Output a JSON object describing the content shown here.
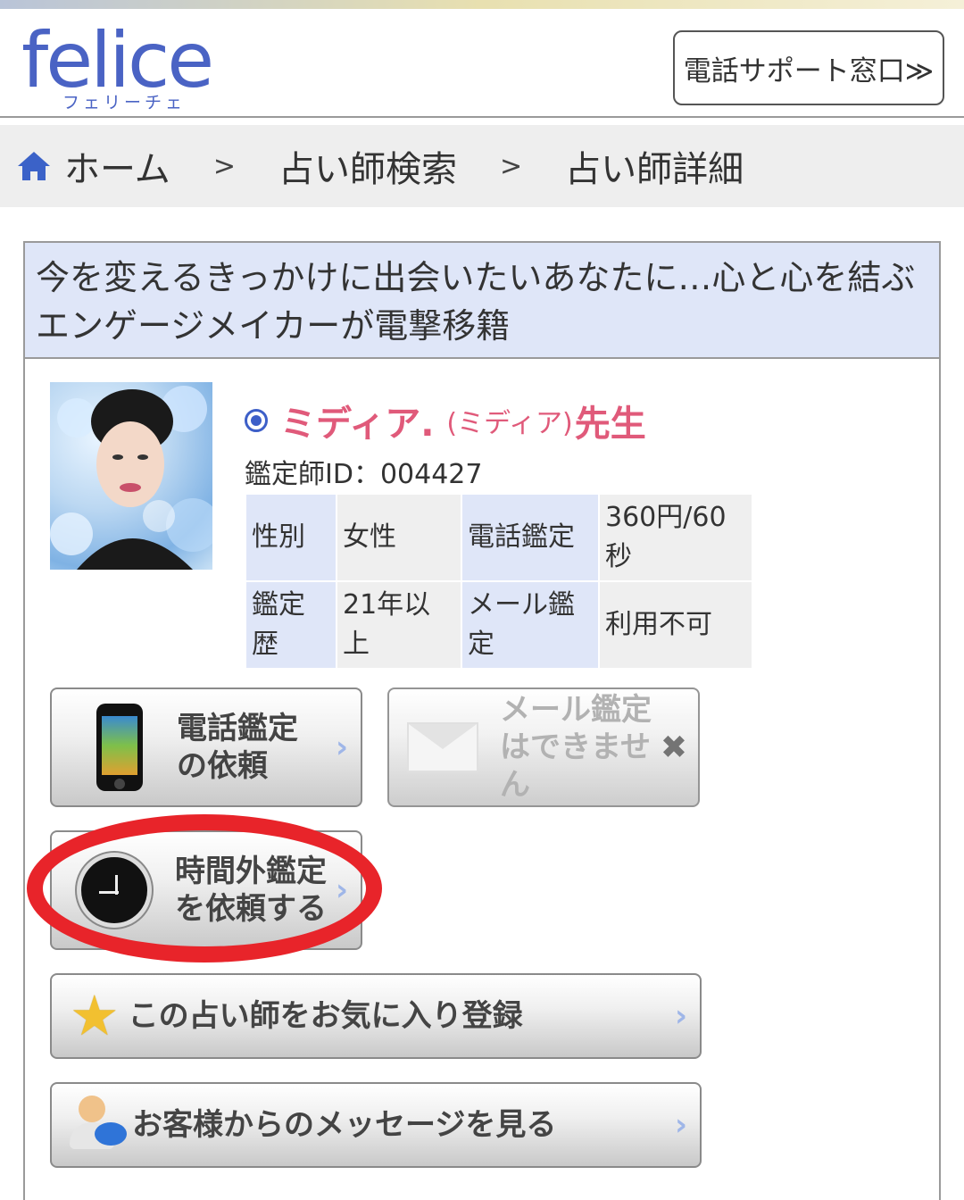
{
  "header": {
    "logo_text": "felice",
    "logo_subtext": "フェリーチェ",
    "support_button": "電話サポート窓口≫"
  },
  "breadcrumb": {
    "home": "ホーム",
    "separator": ">",
    "search": "占い師検索",
    "detail": "占い師詳細"
  },
  "profile": {
    "headline": "今を変えるきっかけに出会いたいあなたに…心と心を結ぶエンゲージメイカーが電撃移籍",
    "name": "ミディア.",
    "reading": "(ミディア)",
    "suffix": "先生",
    "reader_id": "鑑定師ID：004427",
    "table": {
      "gender_label": "性別",
      "gender_value": "女性",
      "phone_label": "電話鑑定",
      "phone_value": "360円/60秒",
      "experience_label": "鑑定歴",
      "experience_value": "21年以上",
      "mail_label": "メール鑑定",
      "mail_value": "利用不可"
    }
  },
  "buttons": {
    "phone_request": "電話鑑定の依頼",
    "mail_unavailable": "メール鑑定はできません",
    "after_hours": "時間外鑑定を依頼する",
    "favorite": "この占い師をお気に入り登録",
    "messages": "お客様からのメッセージを見る"
  },
  "icons": {
    "chevron": "›",
    "close": "✖",
    "star": "★"
  },
  "colors": {
    "brand": "#4a63c4",
    "name": "#e05a7a",
    "highlight_circle": "#e8242a"
  }
}
